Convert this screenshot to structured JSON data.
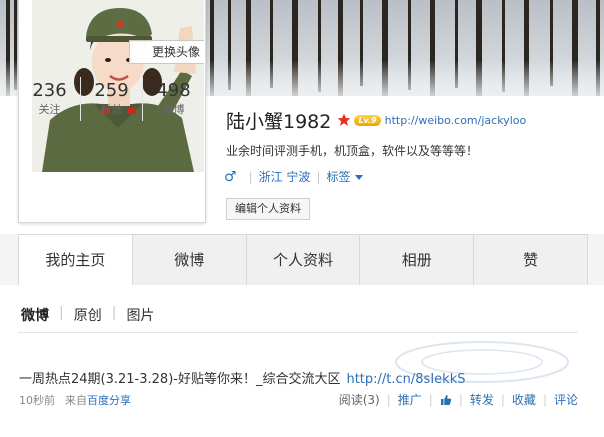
{
  "profile": {
    "name": "陆小蟹1982",
    "level_badge": "Lv.9",
    "homepage": "http://weibo.com/jackyloo",
    "intro": "业余时间评测手机，机顶盒，软件以及等等等！",
    "gender_symbol": "♂",
    "location": "浙江 宁波",
    "tags_label": "标签",
    "change_avatar": "更换头像",
    "edit_profile": "编辑个人资料",
    "stats": [
      {
        "num": "236",
        "label": "关注"
      },
      {
        "num": "259",
        "label": "粉丝"
      },
      {
        "num": "498",
        "label": "微博"
      }
    ]
  },
  "tabs": [
    {
      "label": "我的主页"
    },
    {
      "label": "微博"
    },
    {
      "label": "个人资料"
    },
    {
      "label": "相册"
    },
    {
      "label": "赞"
    }
  ],
  "feed": {
    "subtabs": [
      {
        "label": "微博"
      },
      {
        "label": "原创"
      },
      {
        "label": "图片"
      }
    ],
    "post": {
      "text": "一周热点24期(3.21-3.28)-好贴等你来！_综合交流大区",
      "link": "http://t.cn/8sIekkS",
      "time": "10秒前",
      "source_prefix": "来自",
      "source": "百度分享",
      "read": "阅读(3)",
      "promote": "推广",
      "repost": "转发",
      "favorite": "收藏",
      "comment": "评论"
    }
  },
  "colors": {
    "link": "#2c6fb5",
    "badge": "#f2a400",
    "star": "#e8331f"
  }
}
